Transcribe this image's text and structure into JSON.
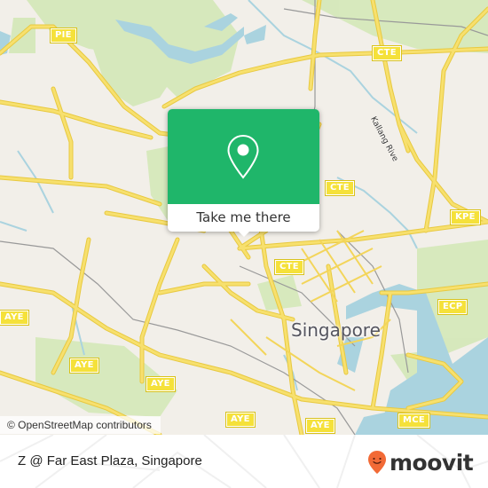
{
  "map": {
    "city_label": "Singapore",
    "river_label": "Kallang Rive",
    "highway_shields": [
      {
        "id": "pie",
        "label": "PIE"
      },
      {
        "id": "cte-north",
        "label": "CTE"
      },
      {
        "id": "cte-mid",
        "label": "CTE"
      },
      {
        "id": "cte-south",
        "label": "CTE"
      },
      {
        "id": "kpe",
        "label": "KPE"
      },
      {
        "id": "ecp",
        "label": "ECP"
      },
      {
        "id": "aye-west",
        "label": "AYE"
      },
      {
        "id": "aye-1",
        "label": "AYE"
      },
      {
        "id": "aye-2",
        "label": "AYE"
      },
      {
        "id": "aye-3",
        "label": "AYE"
      },
      {
        "id": "aye-4",
        "label": "AYE"
      },
      {
        "id": "mce",
        "label": "MCE"
      }
    ],
    "attribution": "© OpenStreetMap contributors",
    "colors": {
      "land": "#f2efe9",
      "park": "#d4e8b8",
      "water": "#aad3df",
      "road": "#f7e06e",
      "highway_shield": "#f5e13a"
    }
  },
  "popup": {
    "icon": "map-pin-icon",
    "action_label": "Take me there",
    "accent_color": "#1fb66a"
  },
  "footer": {
    "place_name": "Z @ Far East Plaza, Singapore",
    "brand": {
      "name": "moovit",
      "icon": "moovit-pin-logo-icon",
      "color": "#f26a36"
    }
  }
}
